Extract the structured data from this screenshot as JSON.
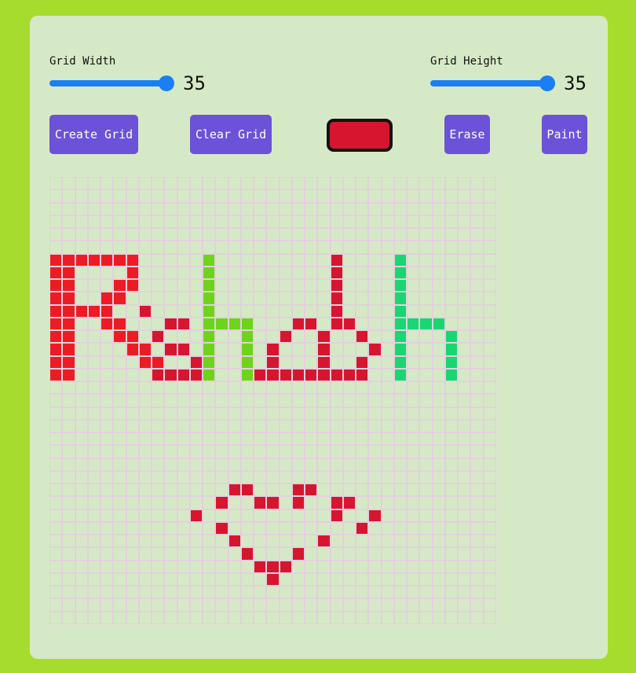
{
  "controls": {
    "grid_width": {
      "label": "Grid Width",
      "value": "35"
    },
    "grid_height": {
      "label": "Grid Height",
      "value": "35"
    }
  },
  "buttons": {
    "create_grid": "Create Grid",
    "clear_grid": "Clear Grid",
    "erase": "Erase",
    "paint": "Paint"
  },
  "selected_color": "#d6162e",
  "grid": {
    "columns": 35,
    "rows": 35,
    "colors": {
      "R": "#ed1c24",
      "D": "#d6162e",
      "G": "#6ed41a",
      "T": "#18d672"
    },
    "cells": [
      "...................................",
      "...................................",
      "...................................",
      "...................................",
      "...................................",
      "...................................",
      "RRRRRRR.....G.........D....T.......",
      "RR....R.....G.........D....T.......",
      "RR...RR.....G.........D....T.......",
      "RR..RR......G.........D....T.......",
      "RRRRR..D....G.........D....T.......",
      "RR..RR...DD.GGGG...DD.DD...TTTT....",
      "RR...RR.D...G..G..D..D..D..T...T...",
      "RR....RR.DD.G..G.D...D...D.T...T...",
      "RR.....RR..DG..G.D...D..D..T...T...",
      "RR......DDDDG..GDDDDDDDDD..T...T...",
      "...................................",
      "...................................",
      "...................................",
      "...................................",
      "...................................",
      "...................................",
      "...................................",
      "...................................",
      "..............DD...DD..............",
      ".............D..DD.D..DD...........",
      "...........D..........D..D.........",
      ".............D..........D..........",
      "..............D......D.............",
      "...............D...D...............",
      "................DDD................",
      ".................D.................",
      "...................................",
      "...................................",
      "..................................."
    ]
  }
}
